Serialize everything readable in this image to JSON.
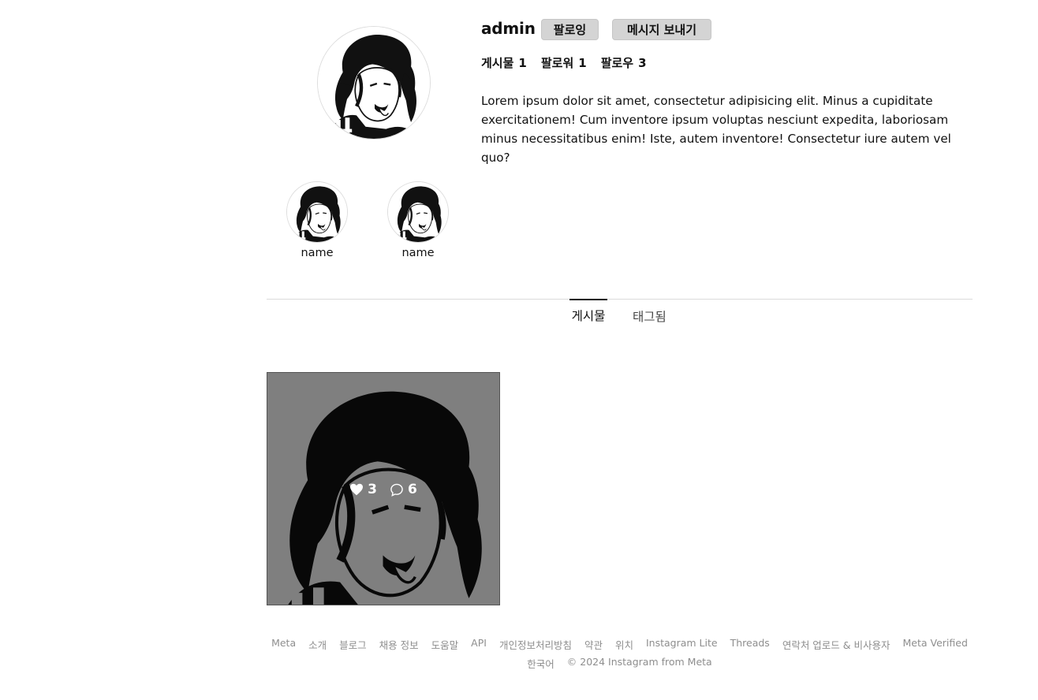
{
  "profile": {
    "username": "admin",
    "follow_label": "팔로잉",
    "message_label": "메시지 보내기",
    "stats": [
      {
        "label": "게시물",
        "value": "1"
      },
      {
        "label": "팔로워",
        "value": "1"
      },
      {
        "label": "팔로우",
        "value": "3"
      }
    ],
    "bio": "Lorem ipsum dolor sit amet, consectetur adipisicing elit. Minus a cupiditate exercitationem! Cum inventore ipsum voluptas nesciunt expedita, laboriosam minus necessitatibus enim! Iste, autem inventore! Consectetur iure autem vel quo?"
  },
  "highlights": [
    {
      "label": "name"
    },
    {
      "label": "name"
    }
  ],
  "tabs": [
    {
      "label": "게시물",
      "active": true
    },
    {
      "label": "태그됨",
      "active": false
    }
  ],
  "posts": [
    {
      "likes": "3",
      "comments": "6"
    }
  ],
  "footer": {
    "links": [
      "Meta",
      "소개",
      "블로그",
      "채용 정보",
      "도움말",
      "API",
      "개인정보처리방침",
      "약관",
      "위치",
      "Instagram Lite",
      "Threads",
      "연락처 업로드 & 비사용자",
      "Meta Verified"
    ],
    "language": "한국어",
    "copyright": "© 2024 Instagram from Meta"
  }
}
